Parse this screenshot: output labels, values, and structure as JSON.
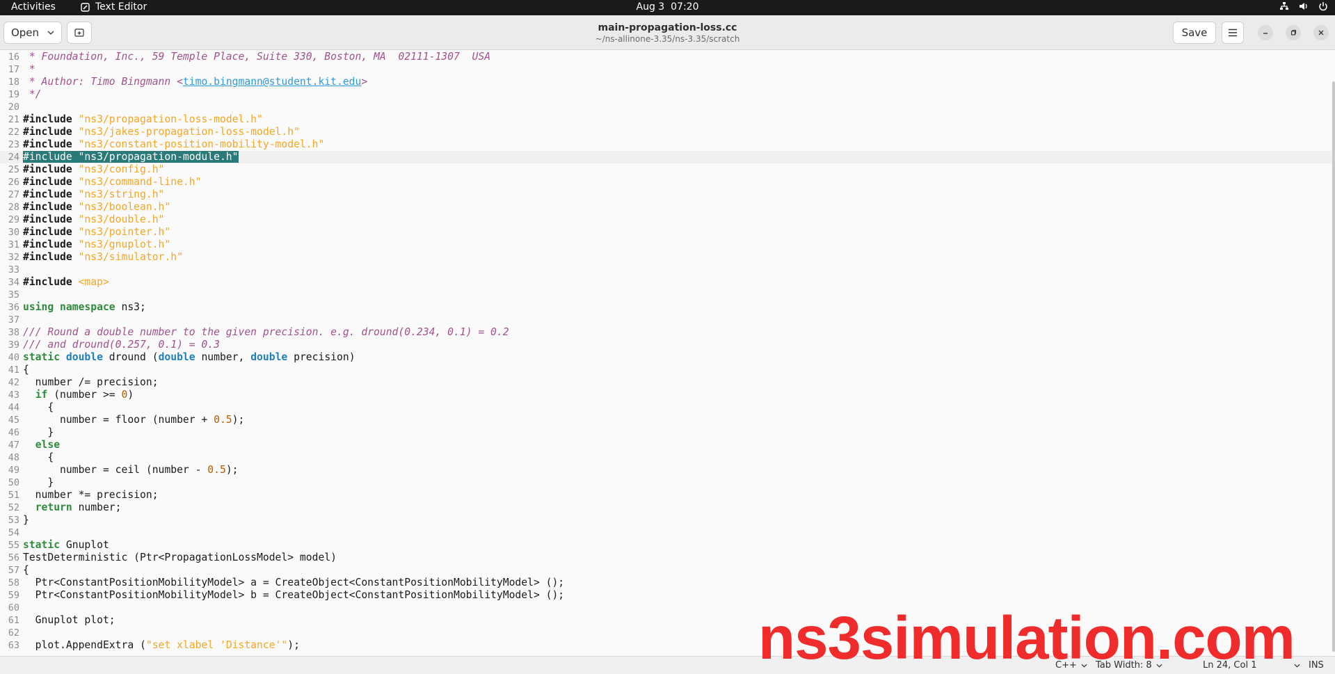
{
  "topbar": {
    "activities": "Activities",
    "app_name": "Text Editor",
    "app_icon": "text-editor-icon",
    "date": "Aug 3",
    "time": "07:20",
    "tray_icons": [
      "network-icon",
      "volume-icon",
      "power-icon"
    ]
  },
  "header": {
    "open_label": "Open",
    "save_label": "Save",
    "title": "main-propagation-loss.cc",
    "subtitle": "~/ns-allinone-3.35/ns-3.35/scratch"
  },
  "editor": {
    "current_line": 24,
    "lines": [
      {
        "n": "16",
        "tokens": [
          {
            "t": " * Foundation, Inc., 59 Temple Place, Suite 330, Boston, MA  02111-1307  USA",
            "c": "comment"
          }
        ]
      },
      {
        "n": "17",
        "tokens": [
          {
            "t": " *",
            "c": "comment"
          }
        ]
      },
      {
        "n": "18",
        "tokens": [
          {
            "t": " * Author: Timo Bingmann <",
            "c": "comment"
          },
          {
            "t": "timo.bingmann@student.kit.edu",
            "c": "link"
          },
          {
            "t": ">",
            "c": "comment"
          }
        ]
      },
      {
        "n": "19",
        "tokens": [
          {
            "t": " */",
            "c": "comment"
          }
        ]
      },
      {
        "n": "20",
        "tokens": []
      },
      {
        "n": "21",
        "tokens": [
          {
            "t": "#include ",
            "c": "pre"
          },
          {
            "t": "\"ns3/propagation-loss-model.h\"",
            "c": "str"
          }
        ]
      },
      {
        "n": "22",
        "tokens": [
          {
            "t": "#include ",
            "c": "pre"
          },
          {
            "t": "\"ns3/jakes-propagation-loss-model.h\"",
            "c": "str"
          }
        ]
      },
      {
        "n": "23",
        "tokens": [
          {
            "t": "#include ",
            "c": "pre"
          },
          {
            "t": "\"ns3/constant-position-mobility-model.h\"",
            "c": "str"
          }
        ]
      },
      {
        "n": "24",
        "tokens": [
          {
            "t": "#include \"ns3/propagation-module.h\"",
            "c": "sel"
          }
        ]
      },
      {
        "n": "25",
        "tokens": [
          {
            "t": "#include ",
            "c": "pre"
          },
          {
            "t": "\"ns3/config.h\"",
            "c": "str"
          }
        ]
      },
      {
        "n": "26",
        "tokens": [
          {
            "t": "#include ",
            "c": "pre"
          },
          {
            "t": "\"ns3/command-line.h\"",
            "c": "str"
          }
        ]
      },
      {
        "n": "27",
        "tokens": [
          {
            "t": "#include ",
            "c": "pre"
          },
          {
            "t": "\"ns3/string.h\"",
            "c": "str"
          }
        ]
      },
      {
        "n": "28",
        "tokens": [
          {
            "t": "#include ",
            "c": "pre"
          },
          {
            "t": "\"ns3/boolean.h\"",
            "c": "str"
          }
        ]
      },
      {
        "n": "29",
        "tokens": [
          {
            "t": "#include ",
            "c": "pre"
          },
          {
            "t": "\"ns3/double.h\"",
            "c": "str"
          }
        ]
      },
      {
        "n": "30",
        "tokens": [
          {
            "t": "#include ",
            "c": "pre"
          },
          {
            "t": "\"ns3/pointer.h\"",
            "c": "str"
          }
        ]
      },
      {
        "n": "31",
        "tokens": [
          {
            "t": "#include ",
            "c": "pre"
          },
          {
            "t": "\"ns3/gnuplot.h\"",
            "c": "str"
          }
        ]
      },
      {
        "n": "32",
        "tokens": [
          {
            "t": "#include ",
            "c": "pre"
          },
          {
            "t": "\"ns3/simulator.h\"",
            "c": "str"
          }
        ]
      },
      {
        "n": "33",
        "tokens": []
      },
      {
        "n": "34",
        "tokens": [
          {
            "t": "#include ",
            "c": "pre"
          },
          {
            "t": "<map>",
            "c": "str"
          }
        ]
      },
      {
        "n": "35",
        "tokens": []
      },
      {
        "n": "36",
        "tokens": [
          {
            "t": "using namespace",
            "c": "kw"
          },
          {
            "t": " ns3;",
            "c": ""
          }
        ]
      },
      {
        "n": "37",
        "tokens": []
      },
      {
        "n": "38",
        "tokens": [
          {
            "t": "/// Round a double number to the given precision. e.g. dround(0.234, 0.1) = 0.2",
            "c": "comment"
          }
        ]
      },
      {
        "n": "39",
        "tokens": [
          {
            "t": "/// and dround(0.257, 0.1) = 0.3",
            "c": "comment"
          }
        ]
      },
      {
        "n": "40",
        "tokens": [
          {
            "t": "static",
            "c": "kw"
          },
          {
            "t": " ",
            "c": ""
          },
          {
            "t": "double",
            "c": "type"
          },
          {
            "t": " dround (",
            "c": ""
          },
          {
            "t": "double",
            "c": "type"
          },
          {
            "t": " number, ",
            "c": ""
          },
          {
            "t": "double",
            "c": "type"
          },
          {
            "t": " precision)",
            "c": ""
          }
        ]
      },
      {
        "n": "41",
        "tokens": [
          {
            "t": "{",
            "c": ""
          }
        ]
      },
      {
        "n": "42",
        "tokens": [
          {
            "t": "  number /= precision;",
            "c": ""
          }
        ]
      },
      {
        "n": "43",
        "tokens": [
          {
            "t": "  ",
            "c": ""
          },
          {
            "t": "if",
            "c": "kw"
          },
          {
            "t": " (number >= ",
            "c": ""
          },
          {
            "t": "0",
            "c": "num"
          },
          {
            "t": ")",
            "c": ""
          }
        ]
      },
      {
        "n": "44",
        "tokens": [
          {
            "t": "    {",
            "c": ""
          }
        ]
      },
      {
        "n": "45",
        "tokens": [
          {
            "t": "      number = floor (number + ",
            "c": ""
          },
          {
            "t": "0.5",
            "c": "num"
          },
          {
            "t": ");",
            "c": ""
          }
        ]
      },
      {
        "n": "46",
        "tokens": [
          {
            "t": "    }",
            "c": ""
          }
        ]
      },
      {
        "n": "47",
        "tokens": [
          {
            "t": "  ",
            "c": ""
          },
          {
            "t": "else",
            "c": "kw"
          }
        ]
      },
      {
        "n": "48",
        "tokens": [
          {
            "t": "    {",
            "c": ""
          }
        ]
      },
      {
        "n": "49",
        "tokens": [
          {
            "t": "      number = ceil (number - ",
            "c": ""
          },
          {
            "t": "0.5",
            "c": "num"
          },
          {
            "t": ");",
            "c": ""
          }
        ]
      },
      {
        "n": "50",
        "tokens": [
          {
            "t": "    }",
            "c": ""
          }
        ]
      },
      {
        "n": "51",
        "tokens": [
          {
            "t": "  number *= precision;",
            "c": ""
          }
        ]
      },
      {
        "n": "52",
        "tokens": [
          {
            "t": "  ",
            "c": ""
          },
          {
            "t": "return",
            "c": "kw"
          },
          {
            "t": " number;",
            "c": ""
          }
        ]
      },
      {
        "n": "53",
        "tokens": [
          {
            "t": "}",
            "c": ""
          }
        ]
      },
      {
        "n": "54",
        "tokens": []
      },
      {
        "n": "55",
        "tokens": [
          {
            "t": "static",
            "c": "kw"
          },
          {
            "t": " Gnuplot",
            "c": ""
          }
        ]
      },
      {
        "n": "56",
        "tokens": [
          {
            "t": "TestDeterministic (Ptr<PropagationLossModel> model)",
            "c": ""
          }
        ]
      },
      {
        "n": "57",
        "tokens": [
          {
            "t": "{",
            "c": ""
          }
        ]
      },
      {
        "n": "58",
        "tokens": [
          {
            "t": "  Ptr<ConstantPositionMobilityModel> a = CreateObject<ConstantPositionMobilityModel> ();",
            "c": ""
          }
        ]
      },
      {
        "n": "59",
        "tokens": [
          {
            "t": "  Ptr<ConstantPositionMobilityModel> b = CreateObject<ConstantPositionMobilityModel> ();",
            "c": ""
          }
        ]
      },
      {
        "n": "60",
        "tokens": []
      },
      {
        "n": "61",
        "tokens": [
          {
            "t": "  Gnuplot plot;",
            "c": ""
          }
        ]
      },
      {
        "n": "62",
        "tokens": []
      },
      {
        "n": "63",
        "tokens": [
          {
            "t": "  plot.AppendExtra (",
            "c": ""
          },
          {
            "t": "\"set xlabel 'Distance'\"",
            "c": "str"
          },
          {
            "t": ");",
            "c": ""
          }
        ]
      }
    ]
  },
  "statusbar": {
    "language": "C++",
    "tab_width": "Tab Width: 8",
    "position": "Ln 24, Col 1",
    "mode": "INS"
  },
  "watermark": "ns3simulation.com",
  "colors": {
    "topbar_bg": "#1a1a1a",
    "selection": "#2a7a7a",
    "comment": "#a0528c",
    "string": "#f5a623",
    "keyword": "#2f8b3c",
    "type": "#1f7fb8",
    "watermark": "#ef2b2b"
  }
}
